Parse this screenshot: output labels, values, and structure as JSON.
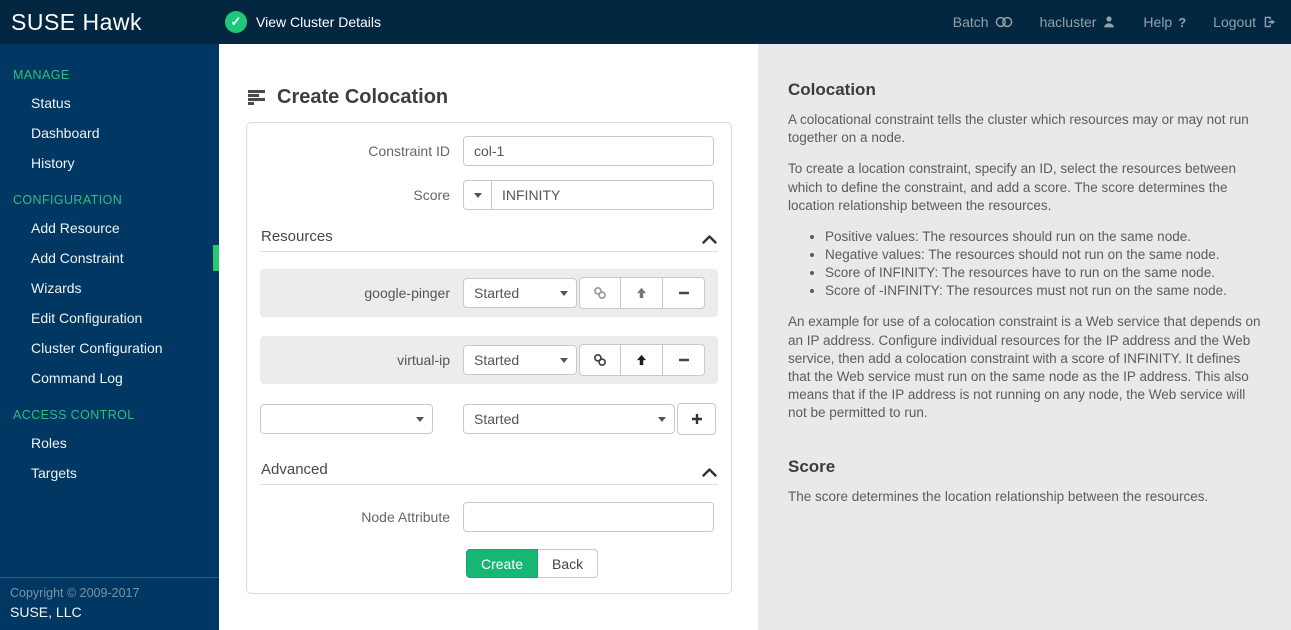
{
  "header": {
    "logo": "SUSE Hawk",
    "cluster_status_label": "View Cluster Details",
    "nav": [
      {
        "label": "Batch",
        "icon": "toggle-icon"
      },
      {
        "label": "hacluster",
        "icon": "user-icon"
      },
      {
        "label": "Help",
        "icon": "help-icon"
      },
      {
        "label": "Logout",
        "icon": "logout-icon"
      }
    ]
  },
  "sidebar": {
    "sections": [
      {
        "title": "MANAGE",
        "items": [
          {
            "label": "Status"
          },
          {
            "label": "Dashboard"
          },
          {
            "label": "History"
          }
        ]
      },
      {
        "title": "CONFIGURATION",
        "items": [
          {
            "label": "Add Resource"
          },
          {
            "label": "Add Constraint",
            "active": true
          },
          {
            "label": "Wizards"
          },
          {
            "label": "Edit Configuration"
          },
          {
            "label": "Cluster Configuration"
          },
          {
            "label": "Command Log"
          }
        ]
      },
      {
        "title": "ACCESS CONTROL",
        "items": [
          {
            "label": "Roles"
          },
          {
            "label": "Targets"
          }
        ]
      }
    ],
    "footer": {
      "copyright": "Copyright © 2009-2017",
      "company": "SUSE, LLC"
    }
  },
  "form": {
    "title": "Create Colocation",
    "constraint_id_label": "Constraint ID",
    "constraint_id_value": "col-1",
    "score_label": "Score",
    "score_value": "INFINITY",
    "resources_section_label": "Resources",
    "resources": [
      {
        "name": "google-pinger",
        "role": "Started"
      },
      {
        "name": "virtual-ip",
        "role": "Started"
      }
    ],
    "new_resource_value": "",
    "new_resource_role": "Started",
    "advanced_section_label": "Advanced",
    "node_attribute_label": "Node Attribute",
    "node_attribute_value": "",
    "create_label": "Create",
    "back_label": "Back"
  },
  "help_panel": {
    "colocation_title": "Colocation",
    "p1": "A colocational constraint tells the cluster which resources may or may not run together on a node.",
    "p2": "To create a location constraint, specify an ID, select the resources between which to define the constraint, and add a score. The score determines the location relationship between the resources.",
    "bullets": [
      "Positive values: The resources should run on the same node.",
      "Negative values: The resources should not run on the same node.",
      "Score of INFINITY: The resources have to run on the same node.",
      "Score of -INFINITY: The resources must not run on the same node."
    ],
    "p3": "An example for use of a colocation constraint is a Web service that depends on an IP address. Configure individual resources for the IP address and the Web service, then add a colocation constraint with a score of INFINITY. It defines that the Web service must run on the same node as the IP address. This also means that if the IP address is not running on any node, the Web service will not be permitted to run.",
    "score_title": "Score",
    "score_text": "The score determines the location relationship between the resources."
  },
  "colors": {
    "header_navy": "#032740",
    "sidebar_navy": "#003763",
    "suse_green": "#2fbe7f",
    "active_bar_green": "#23cb71",
    "status_check_green": "#1fc878",
    "create_button_green": "#16b673",
    "help_panel_grey": "#e9e9e9"
  }
}
